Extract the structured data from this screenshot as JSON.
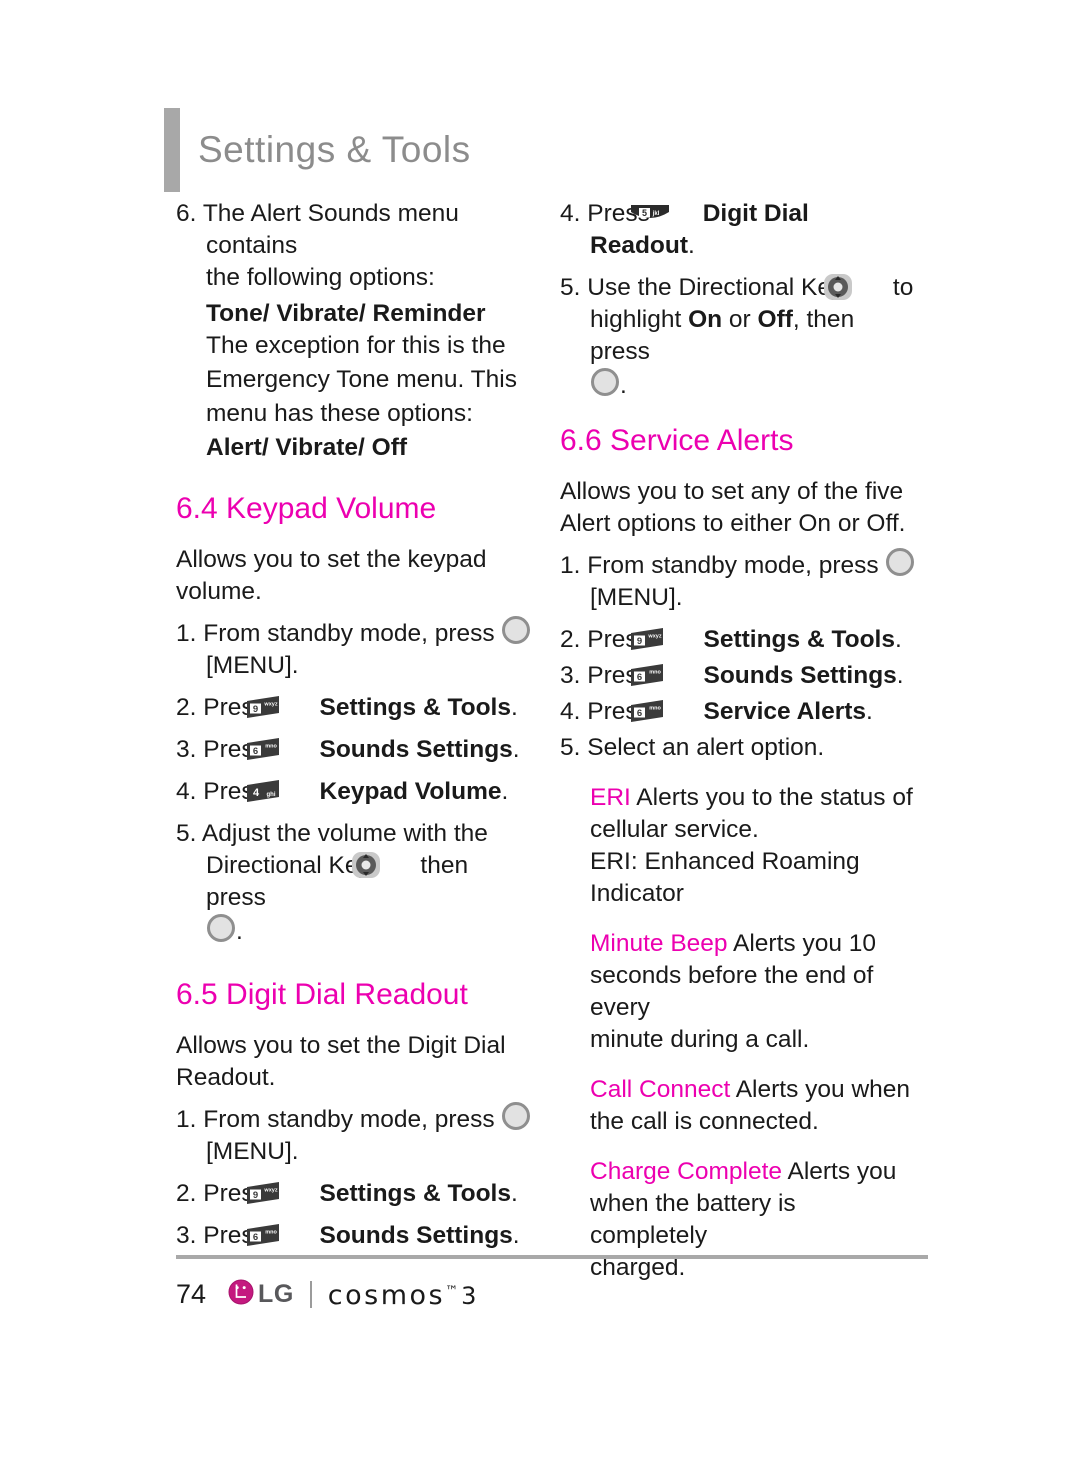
{
  "header": {
    "title": "Settings & Tools"
  },
  "icons": {
    "menu_key": "menu-circle-key-icon",
    "directional_key": "directional-key-icon",
    "key_9": {
      "digit": "9",
      "letters": "wxyz"
    },
    "key_6": {
      "digit": "6",
      "letters": "mno"
    },
    "key_5": {
      "digit": "5",
      "letters": "jkl"
    },
    "key_4": {
      "digit": "4",
      "letters": "ghi"
    }
  },
  "colors": {
    "accent": "#ec00b0",
    "header_gray": "#8c8c8c",
    "rule_gray": "#a9a9a9"
  },
  "left_column": {
    "step6": {
      "number": "6.",
      "line1": "The Alert Sounds menu contains",
      "line2": "the following options:",
      "bold1": "Tone/ Vibrate/ Reminder",
      "line3": "The exception for this is the",
      "line4": "Emergency Tone menu. This",
      "line5": "menu has these options:",
      "bold2": "Alert/ Vibrate/ Off"
    },
    "section_keypad_volume": {
      "title": "6.4 Keypad Volume",
      "intro_line1": "Allows you to set the keypad",
      "intro_line2": "volume.",
      "steps": [
        {
          "num": "1.",
          "pre": "From standby mode, press ",
          "icon": "menu_key",
          "post": "",
          "second_line": "[MENU]."
        },
        {
          "num": "2.",
          "pre": "Press ",
          "icon": "key_9",
          "bold": "Settings & Tools",
          "post": "."
        },
        {
          "num": "3.",
          "pre": "Press ",
          "icon": "key_6",
          "bold": "Sounds Settings",
          "post": "."
        },
        {
          "num": "4.",
          "pre": "Press ",
          "icon": "key_4",
          "bold": "Keypad Volume",
          "post": "."
        },
        {
          "num": "5.",
          "pre": "Adjust the volume with the",
          "line2_pre": "Directional Key ",
          "icon": "directional_key",
          "line2_post": " then press",
          "line3_post": "."
        }
      ]
    },
    "section_digit_dial": {
      "title": "6.5 Digit Dial Readout",
      "intro_line1": "Allows you to set the Digit Dial",
      "intro_line2": "Readout.",
      "steps": [
        {
          "num": "1.",
          "pre": "From standby mode, press ",
          "icon": "menu_key",
          "second_line": "[MENU]."
        },
        {
          "num": "2.",
          "pre": "Press ",
          "icon": "key_9",
          "bold": "Settings & Tools",
          "post": "."
        },
        {
          "num": "3.",
          "pre": "Press ",
          "icon": "key_6",
          "bold": "Sounds Settings",
          "post": "."
        }
      ]
    }
  },
  "right_column": {
    "continued_steps": [
      {
        "num": "4.",
        "pre": "Press ",
        "icon": "key_5",
        "bold": "Digit Dial Readout",
        "post": "."
      },
      {
        "num": "5.",
        "pre": "Use the Directional Key ",
        "icon": "directional_key",
        "post": " to",
        "line2_pre": "highlight ",
        "bold_a": "On",
        "mid": " or ",
        "bold_b": "Off",
        "line2_post": ", then press",
        "line3_post": "."
      }
    ],
    "section_service_alerts": {
      "title": "6.6 Service Alerts",
      "intro_line1": "Allows you to set any of the five",
      "intro_line2": "Alert options to either On or Off.",
      "steps": [
        {
          "num": "1.",
          "pre": "From standby mode, press ",
          "icon": "menu_key",
          "second_line": "[MENU]."
        },
        {
          "num": "2.",
          "pre": "Press ",
          "icon": "key_9",
          "bold": "Settings & Tools",
          "post": "."
        },
        {
          "num": "3.",
          "pre": "Press ",
          "icon": "key_6",
          "bold": "Sounds Settings",
          "post": "."
        },
        {
          "num": "4.",
          "pre": "Press ",
          "icon": "key_6",
          "bold": "Service Alerts",
          "post": "."
        },
        {
          "num": "5.",
          "pre": "Select an alert option.",
          "icon": null
        }
      ],
      "alerts": [
        {
          "term": "ERI",
          "desc_line1": " Alerts you to the status of",
          "desc_line2": "cellular service.",
          "desc_line3": "ERI: Enhanced Roaming Indicator"
        },
        {
          "term": "Minute Beep",
          "desc_line1": " Alerts you 10",
          "desc_line2": "seconds before the end of every",
          "desc_line3": "minute during a call."
        },
        {
          "term": "Call Connect",
          "desc_line1": " Alerts you when",
          "desc_line2": "the call is connected.",
          "desc_line3": ""
        },
        {
          "term": "Charge Complete",
          "desc_line1": " Alerts you",
          "desc_line2": "when the battery is completely",
          "desc_line3": "charged."
        }
      ]
    }
  },
  "footer": {
    "page_number": "74",
    "brand_lg": "LG",
    "brand_product": "cosmos",
    "brand_tm": "™",
    "brand_version": "3"
  }
}
